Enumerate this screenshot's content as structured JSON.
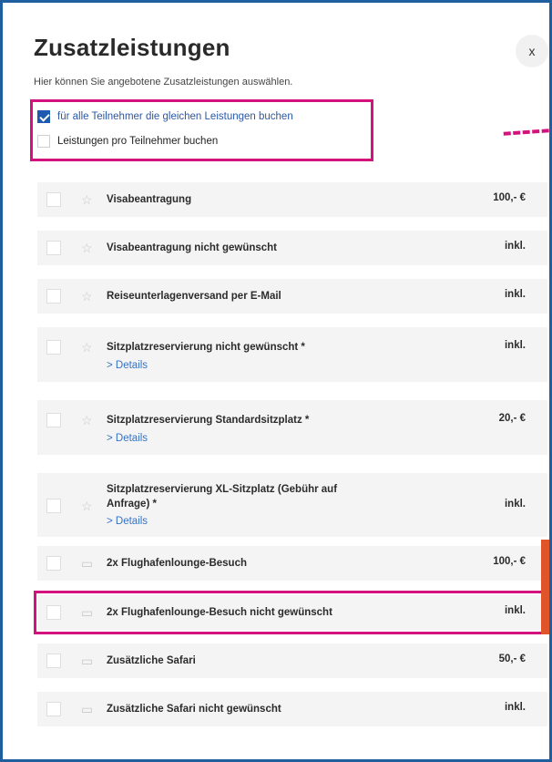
{
  "dialog": {
    "title": "Zusatzleistungen",
    "close_label": "x",
    "subtitle": "Hier können Sie angebotene Zusatzleistungen auswählen."
  },
  "booking_mode": {
    "same_for_all": {
      "label": "für alle Teilnehmer die gleichen Leistungen buchen",
      "checked": true
    },
    "per_participant": {
      "label": "Leistungen pro Teilnehmer buchen",
      "checked": false
    }
  },
  "services": [
    {
      "label": "Visabeantragung",
      "price": "100,- €",
      "icon": "star-icon"
    },
    {
      "label": "Visabeantragung nicht gewünscht",
      "price": "inkl.",
      "icon": "star-icon"
    },
    {
      "label": "Reiseunterlagenversand per E-Mail",
      "price": "inkl.",
      "icon": "star-icon"
    },
    {
      "label": "Sitzplatzreservierung nicht gewünscht *",
      "price": "inkl.",
      "icon": "star-icon",
      "details": "> Details"
    },
    {
      "label": "Sitzplatzreservierung Standardsitzplatz *",
      "price": "20,- €",
      "icon": "star-icon",
      "details": "> Details"
    },
    {
      "label": "Sitzplatzreservierung XL-Sitzplatz (Gebühr auf Anfrage) *",
      "price": "inkl.",
      "icon": "star-icon",
      "details": "> Details"
    },
    {
      "label": "2x Flughafenlounge-Besuch",
      "price": "100,- €",
      "icon": "ticket-icon"
    },
    {
      "label": "2x Flughafenlounge-Besuch nicht gewünscht",
      "price": "inkl.",
      "icon": "ticket-icon"
    },
    {
      "label": "Zusätzliche Safari",
      "price": "50,- €",
      "icon": "ticket-icon"
    },
    {
      "label": "Zusätzliche Safari nicht gewünscht",
      "price": "inkl.",
      "icon": "ticket-icon"
    }
  ]
}
